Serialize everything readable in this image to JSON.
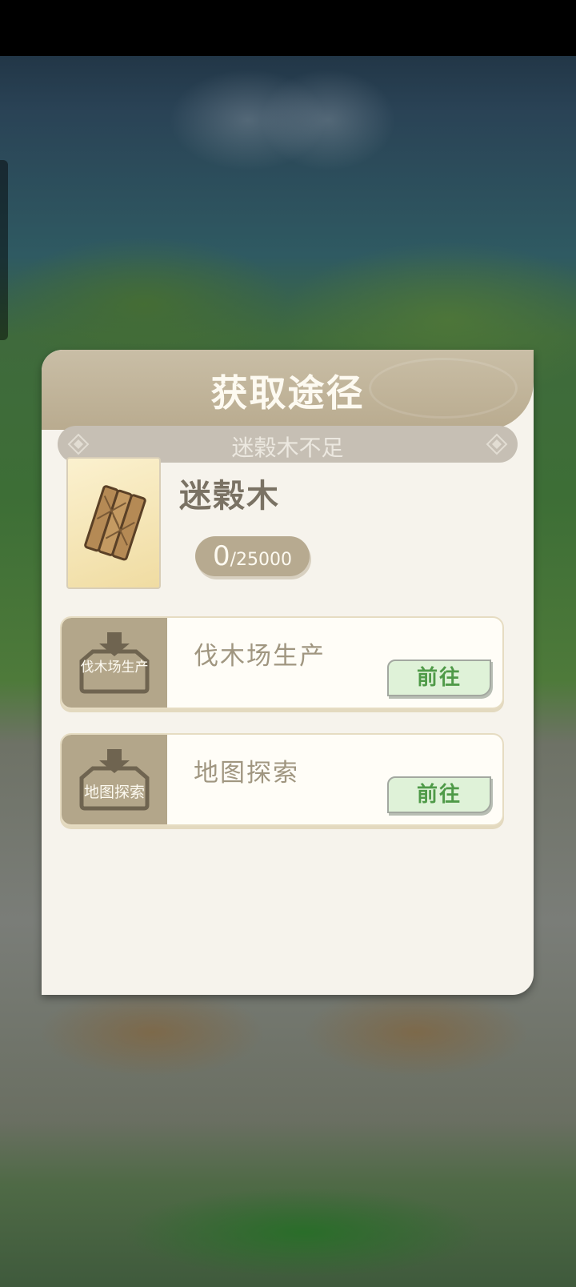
{
  "popup": {
    "title": "获取途径",
    "warning": "迷榖木不足"
  },
  "item": {
    "name": "迷榖木",
    "icon": "wood-plank-icon",
    "count_current": "0",
    "count_max": "/25000"
  },
  "sources": [
    {
      "icon_label": "伐木场生产",
      "name": "伐木场生产",
      "button_label": "前往"
    },
    {
      "icon_label": "地图探索",
      "name": "地图探索",
      "button_label": "前往"
    }
  ],
  "colors": {
    "header": "#b9ab8f",
    "panel": "#f6f3ec",
    "go_button_bg": "#dff2d8",
    "go_button_text": "#4f9a48"
  }
}
